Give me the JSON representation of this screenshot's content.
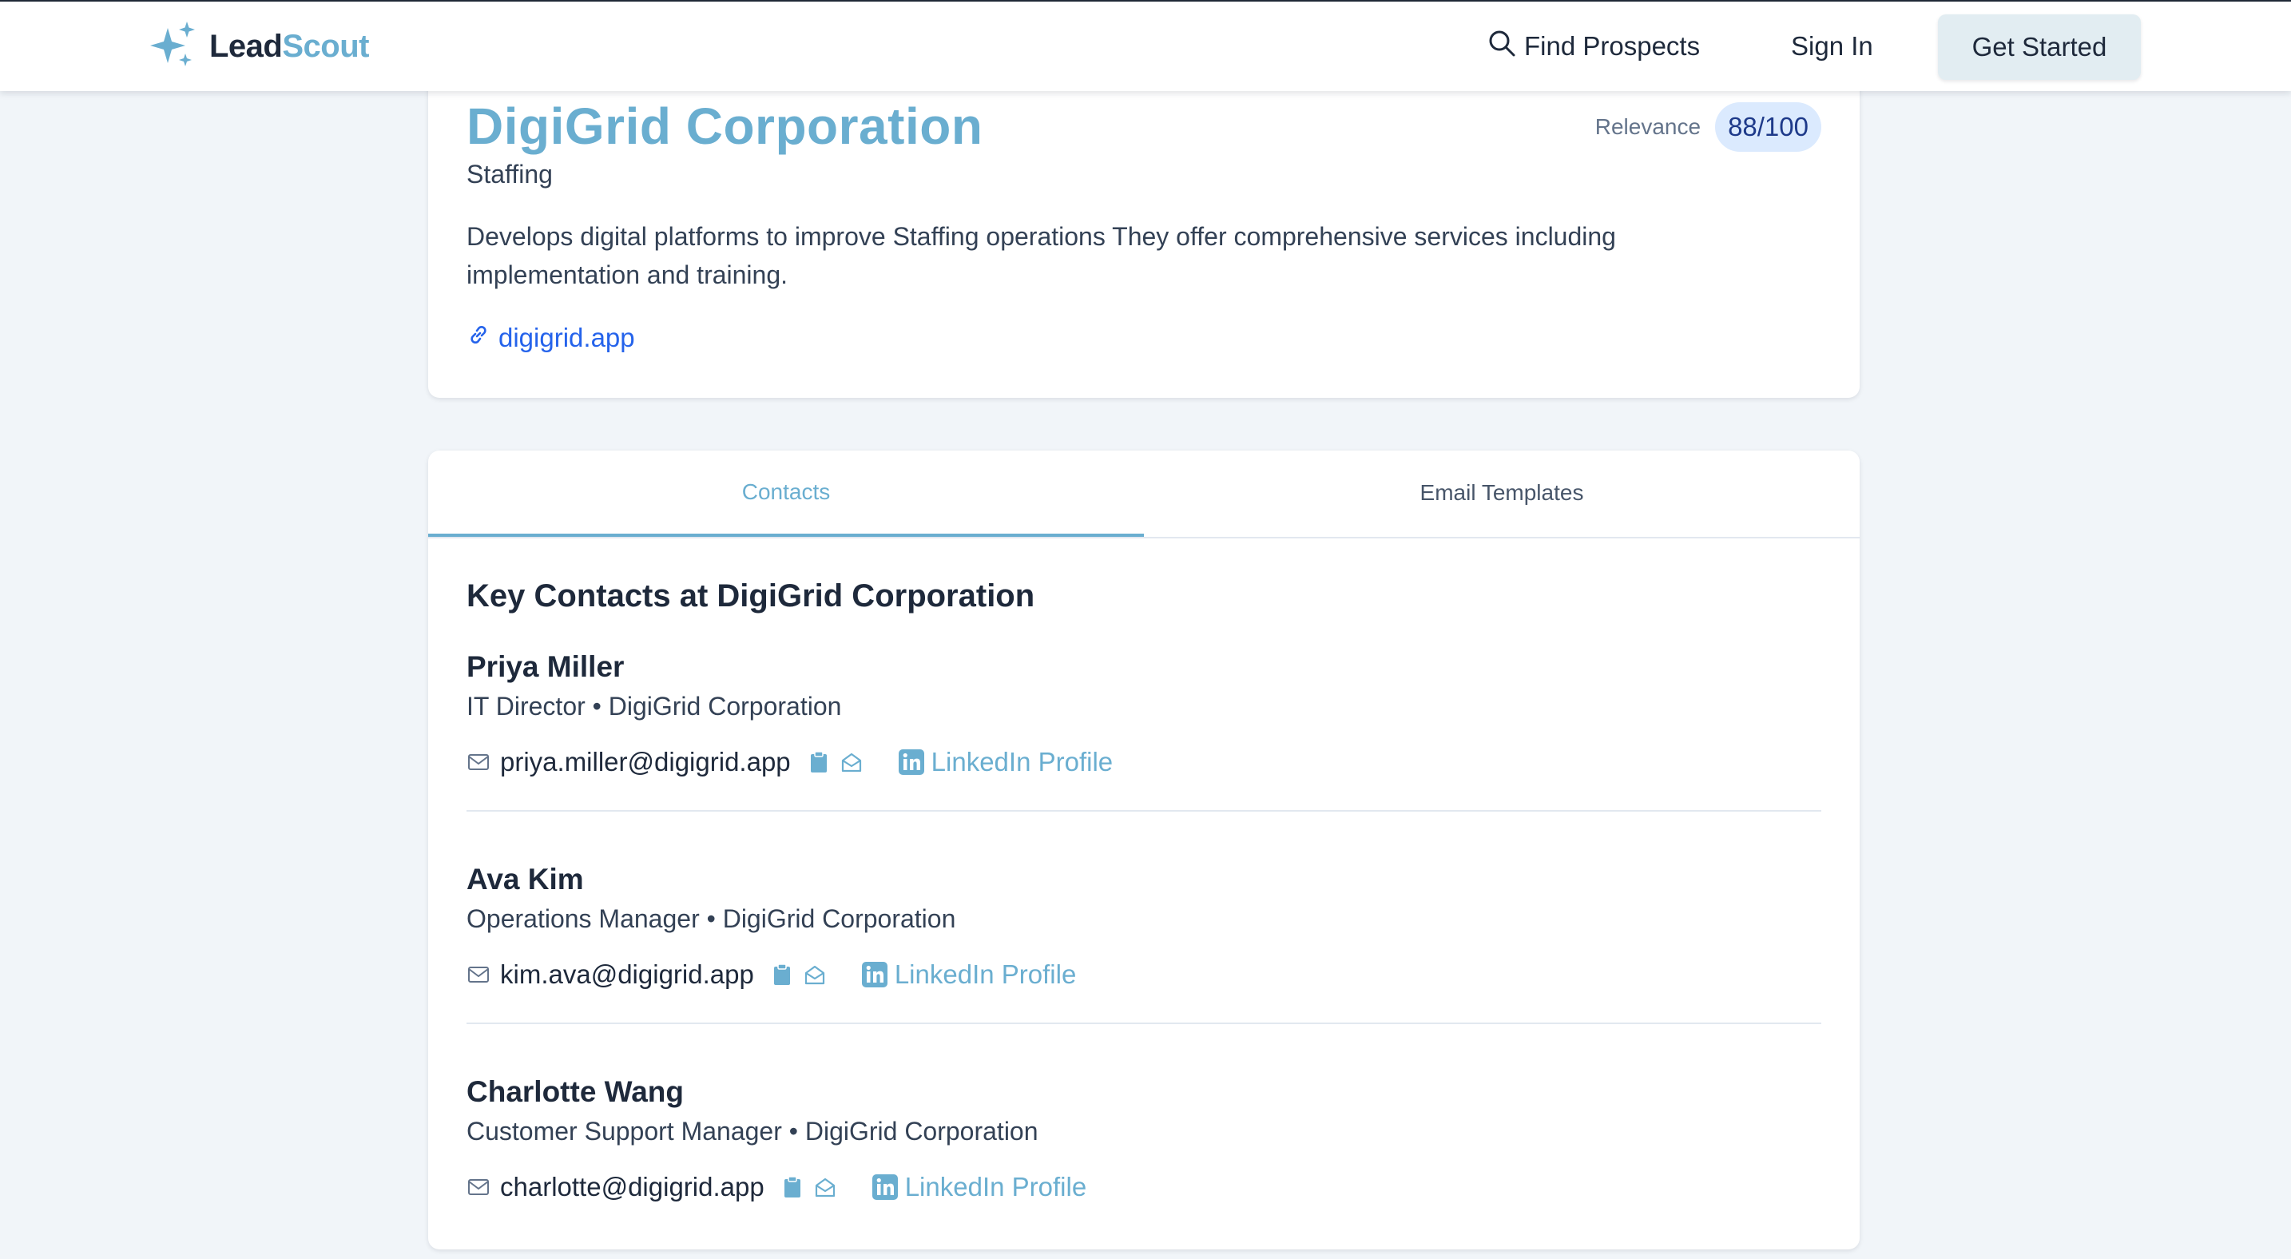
{
  "app": {
    "brand_first": "Lead",
    "brand_second": "Scout",
    "brand_color": "#6aaed0"
  },
  "nav": {
    "find_prospects": "Find Prospects",
    "sign_in": "Sign In",
    "get_started": "Get Started"
  },
  "company": {
    "name": "DigiGrid Corporation",
    "industry": "Staffing",
    "description": "Develops digital platforms to improve Staffing operations They offer comprehensive services including implementation and training.",
    "website": "digigrid.app",
    "relevance_label": "Relevance",
    "relevance_score": "88/100"
  },
  "tabs": {
    "contacts": "Contacts",
    "email_templates": "Email Templates",
    "active": "Contacts"
  },
  "contacts_section": {
    "title": "Key Contacts at DigiGrid Corporation",
    "contacts": [
      {
        "name": "Priya Miller",
        "role": "IT Director • DigiGrid Corporation",
        "email": "priya.miller@digigrid.app",
        "linkedin_label": "LinkedIn Profile"
      },
      {
        "name": "Ava Kim",
        "role": "Operations Manager • DigiGrid Corporation",
        "email": "kim.ava@digigrid.app",
        "linkedin_label": "LinkedIn Profile"
      },
      {
        "name": "Charlotte Wang",
        "role": "Customer Support Manager • DigiGrid Corporation",
        "email": "charlotte@digigrid.app",
        "linkedin_label": "LinkedIn Profile"
      }
    ]
  },
  "icons": {
    "logo": "sparkles-icon",
    "find": "search-icon",
    "website": "link-icon",
    "email": "mail-icon",
    "copy": "clipboard-icon",
    "compose": "envelope-open-icon",
    "linkedin": "linkedin-icon"
  }
}
